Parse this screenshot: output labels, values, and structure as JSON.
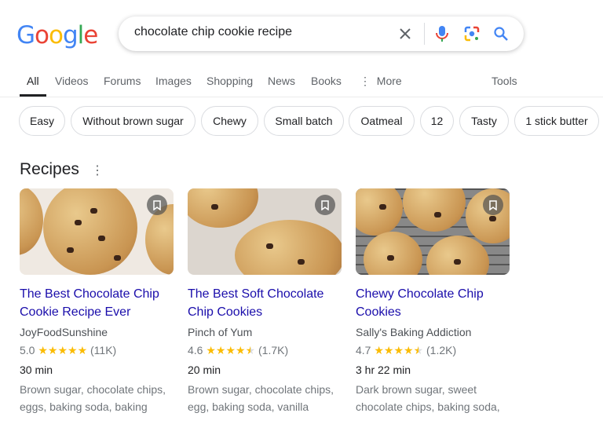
{
  "logo": "Google",
  "search": {
    "query": "chocolate chip cookie recipe"
  },
  "tabs": [
    "All",
    "Videos",
    "Forums",
    "Images",
    "Shopping",
    "News",
    "Books",
    "More"
  ],
  "tools": "Tools",
  "chips": [
    "Easy",
    "Without brown sugar",
    "Chewy",
    "Small batch",
    "Oatmeal",
    "12",
    "Tasty",
    "1 stick butter"
  ],
  "section": {
    "title": "Recipes"
  },
  "recipes": [
    {
      "title": "The Best Chocolate Chip Cookie Recipe Ever",
      "source": "JoyFoodSunshine",
      "rating": "5.0",
      "stars": 5,
      "reviews": "(11K)",
      "time": "30 min",
      "ingredients": "Brown sugar, chocolate chips, eggs, baking soda, baking"
    },
    {
      "title": "The Best Soft Chocolate Chip Cookies",
      "source": "Pinch of Yum",
      "rating": "4.6",
      "stars": 4.5,
      "reviews": "(1.7K)",
      "time": "20 min",
      "ingredients": "Brown sugar, chocolate chips, egg, baking soda, vanilla"
    },
    {
      "title": "Chewy Chocolate Chip Cookies",
      "source": "Sally's Baking Addiction",
      "rating": "4.7",
      "stars": 4.5,
      "reviews": "(1.2K)",
      "time": "3 hr 22 min",
      "ingredients": "Dark brown sugar, sweet chocolate chips, baking soda,"
    }
  ],
  "colors": {
    "link": "#1a0dab",
    "star": "#fbbc04",
    "blue": "#4285f4",
    "red": "#ea4335",
    "yellow": "#fbbc05",
    "green": "#34a853"
  }
}
